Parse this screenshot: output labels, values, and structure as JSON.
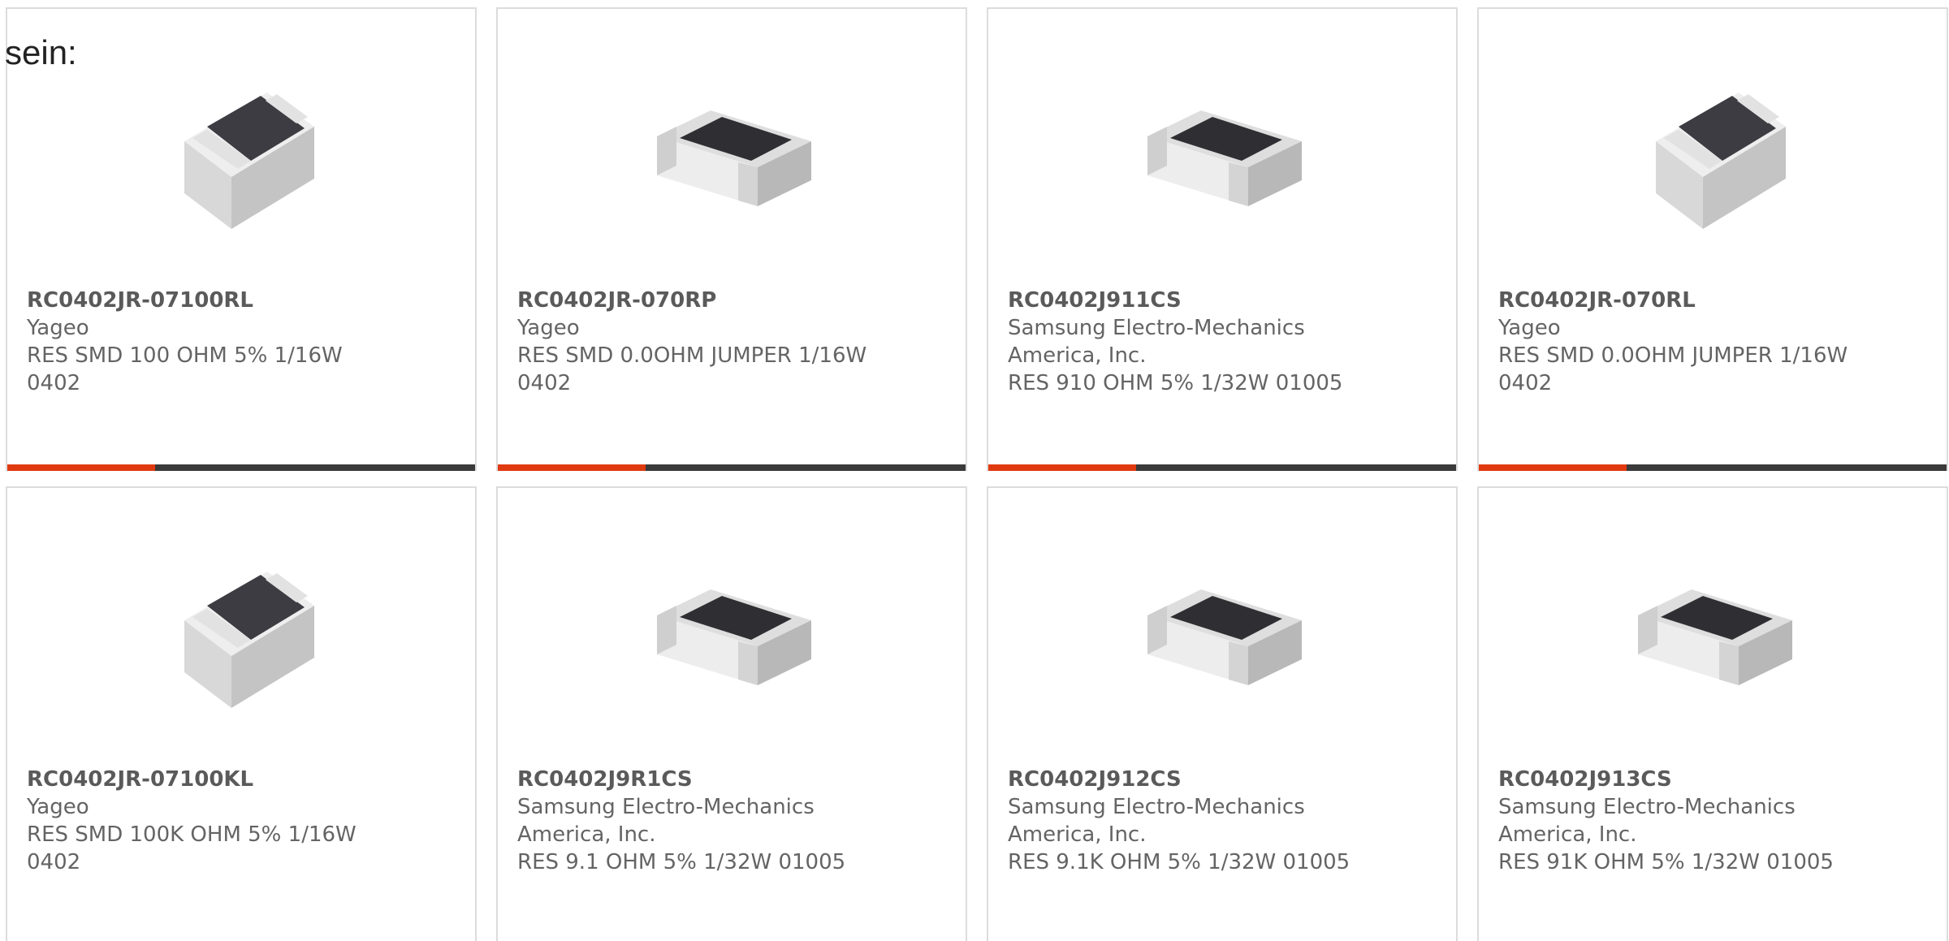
{
  "intro_text": "sein:",
  "colors": {
    "accent": "#e03a10",
    "bar_dark": "#3a3a3a",
    "border": "#dcdcdc",
    "text": "#646464"
  },
  "products": [
    {
      "part_number": "RC0402JR-07100RL",
      "manufacturer": "Yageo",
      "description": "RES SMD 100 OHM 5% 1/16W 0402",
      "image": "smd-resistor-angled-icon"
    },
    {
      "part_number": "RC0402JR-070RP",
      "manufacturer": "Yageo",
      "description": "RES SMD 0.0OHM JUMPER 1/16W 0402",
      "image": "smd-resistor-side-icon"
    },
    {
      "part_number": "RC0402J911CS",
      "manufacturer": "Samsung Electro-Mechanics America, Inc.",
      "description": "RES 910 OHM 5% 1/32W 01005",
      "image": "smd-resistor-side-icon"
    },
    {
      "part_number": "RC0402JR-070RL",
      "manufacturer": "Yageo",
      "description": "RES SMD 0.0OHM JUMPER 1/16W 0402",
      "image": "smd-resistor-angled-icon"
    },
    {
      "part_number": "RC0402JR-07100KL",
      "manufacturer": "Yageo",
      "description": "RES SMD 100K OHM 5% 1/16W 0402",
      "image": "smd-resistor-angled-icon"
    },
    {
      "part_number": "RC0402J9R1CS",
      "manufacturer": "Samsung Electro-Mechanics America, Inc.",
      "description": "RES 9.1 OHM 5% 1/32W 01005",
      "image": "smd-resistor-side-icon"
    },
    {
      "part_number": "RC0402J912CS",
      "manufacturer": "Samsung Electro-Mechanics America, Inc.",
      "description": "RES 9.1K OHM 5% 1/32W 01005",
      "image": "smd-resistor-side-icon"
    },
    {
      "part_number": "RC0402J913CS",
      "manufacturer": "Samsung Electro-Mechanics America, Inc.",
      "description": "RES 91K OHM 5% 1/32W 01005",
      "image": "smd-resistor-side-icon"
    }
  ]
}
